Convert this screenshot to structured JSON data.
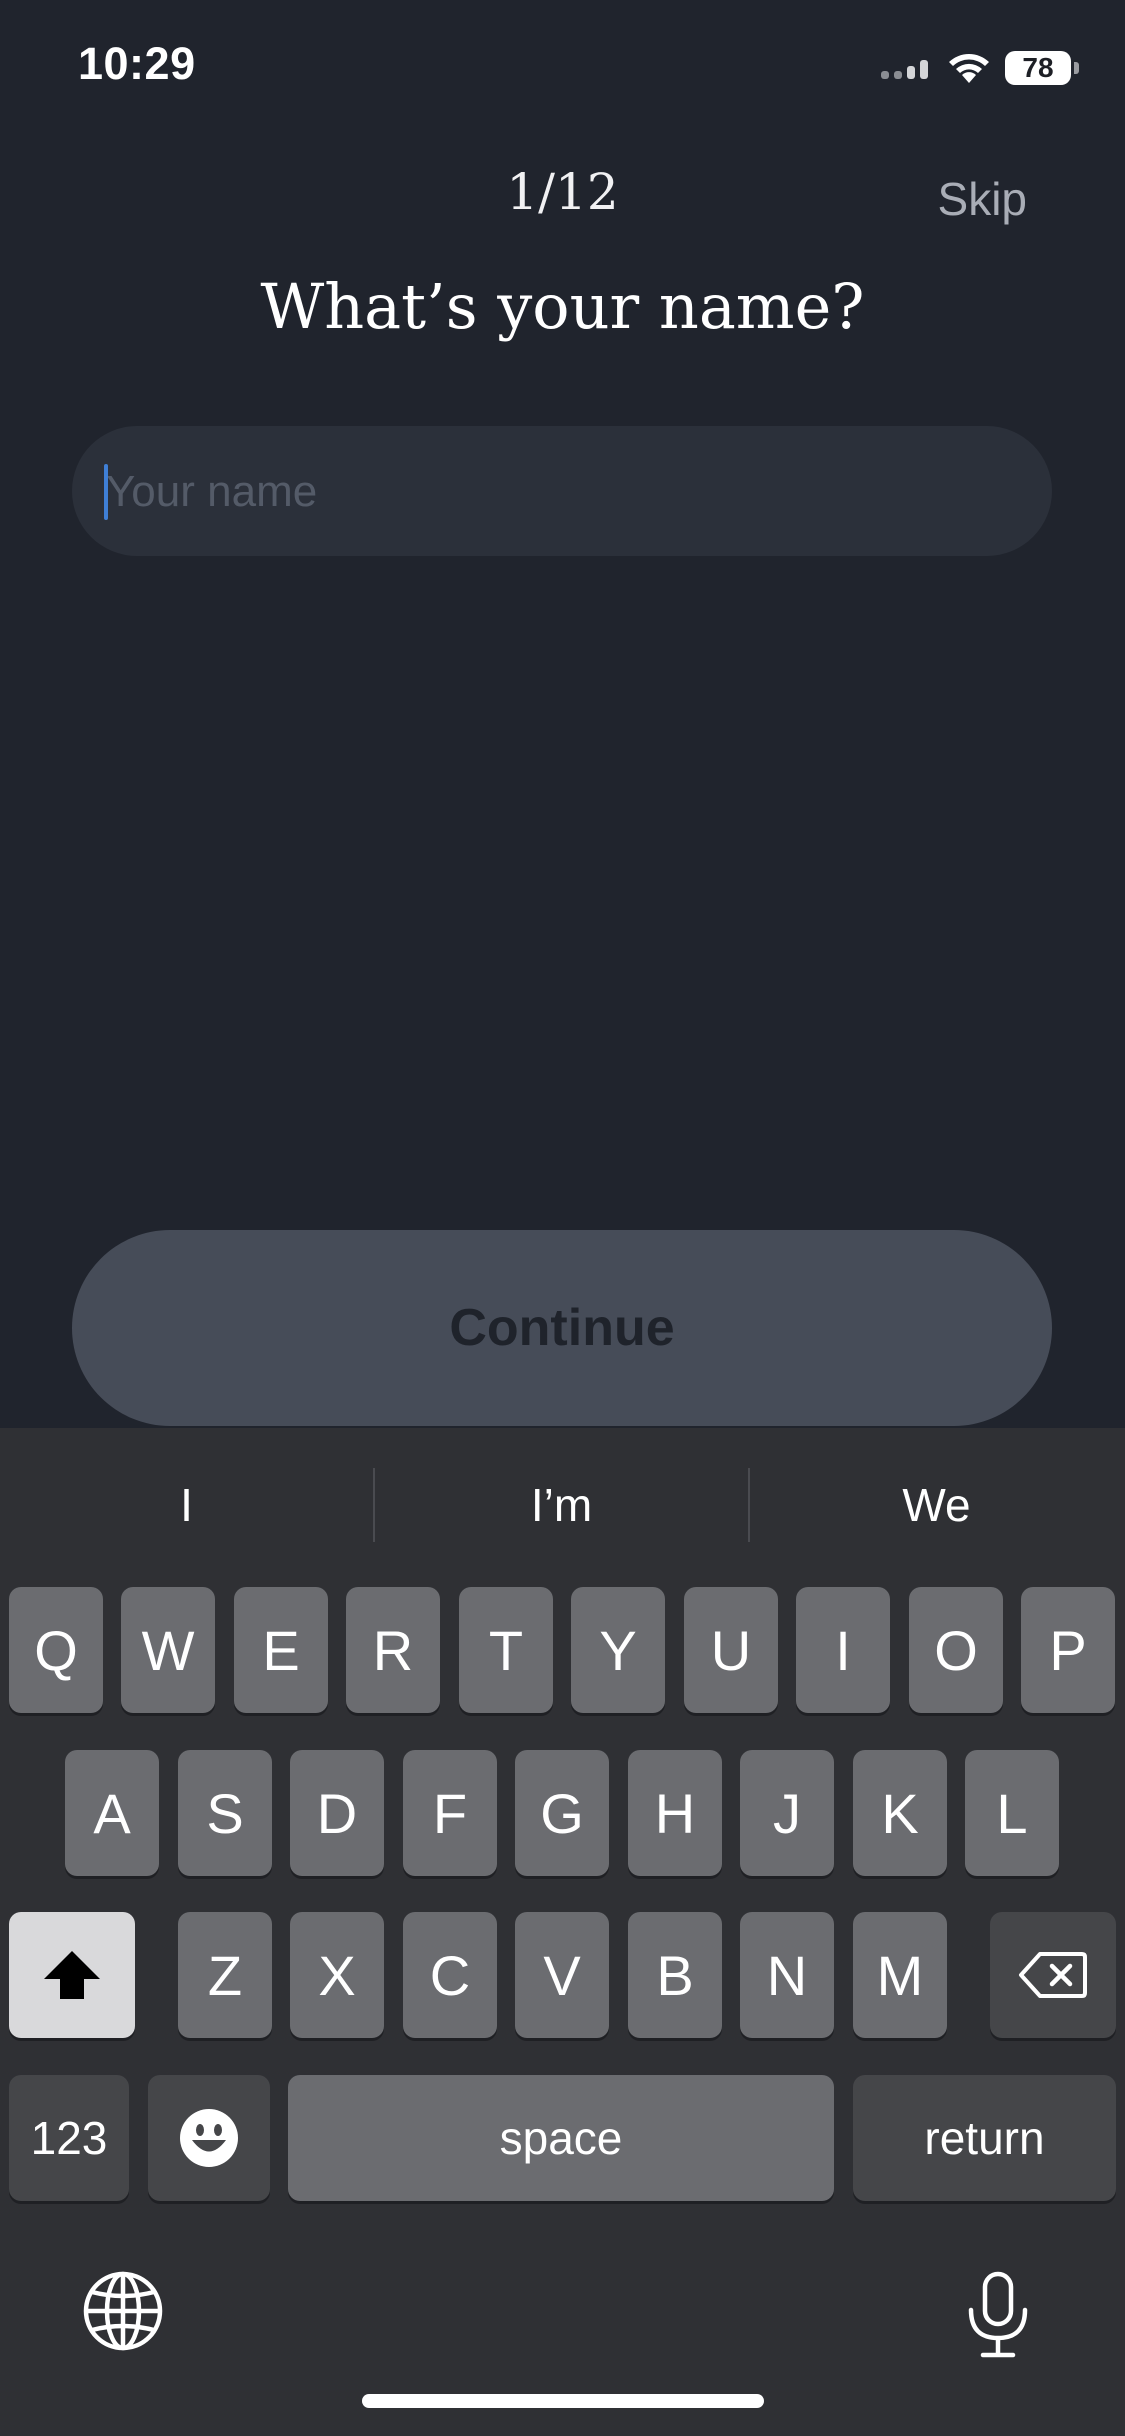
{
  "status_bar": {
    "time": "10:29",
    "battery": "78",
    "icons": [
      "cellular-signal-icon",
      "wifi-icon",
      "battery-icon"
    ]
  },
  "header": {
    "step": "1/12",
    "skip_label": "Skip",
    "title": "What’s your name?"
  },
  "name_field": {
    "placeholder": "Your name",
    "value": ""
  },
  "continue_label": "Continue",
  "keyboard": {
    "suggestions": [
      "I",
      "I’m",
      "We"
    ],
    "row1": [
      "Q",
      "W",
      "E",
      "R",
      "T",
      "Y",
      "U",
      "I",
      "O",
      "P"
    ],
    "row2": [
      "A",
      "S",
      "D",
      "F",
      "G",
      "H",
      "J",
      "K",
      "L"
    ],
    "row3": [
      "Z",
      "X",
      "C",
      "V",
      "B",
      "N",
      "M"
    ],
    "numbers_label": "123",
    "space_label": "space",
    "return_label": "return",
    "icons": [
      "shift-icon",
      "backspace-icon",
      "emoji-icon",
      "globe-icon",
      "microphone-icon"
    ]
  },
  "colors": {
    "background": "#20242d",
    "input_bg": "#2b303a",
    "button_bg": "#464c58",
    "keyboard_bg": "#2f3034",
    "key_bg": "#6b6c70",
    "caret": "#3f7fd6"
  }
}
